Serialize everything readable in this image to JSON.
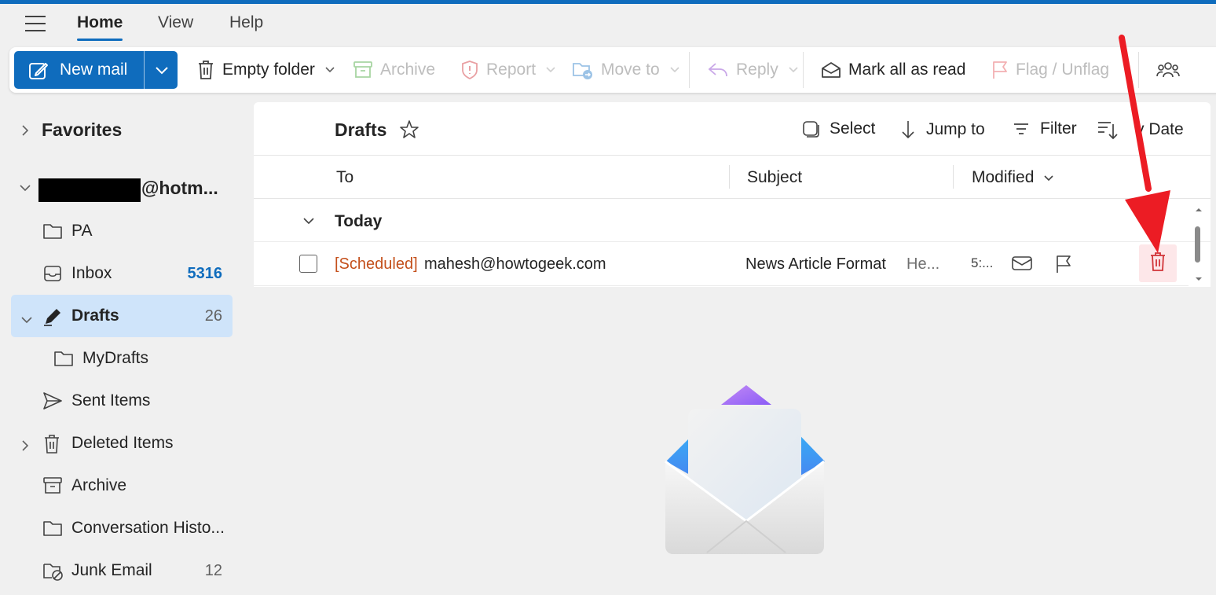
{
  "menu": {
    "tabs": [
      "Home",
      "View",
      "Help"
    ]
  },
  "ribbon": {
    "new_mail": "New mail",
    "empty_folder": "Empty folder",
    "archive": "Archive",
    "report": "Report",
    "move_to": "Move to",
    "reply": "Reply",
    "mark_all_read": "Mark all as read",
    "flag_unflag": "Flag / Unflag"
  },
  "sidebar": {
    "favorites": "Favorites",
    "account_suffix": "@hotm...",
    "folders": [
      {
        "label": "PA",
        "count": ""
      },
      {
        "label": "Inbox",
        "count": "5316"
      },
      {
        "label": "Drafts",
        "count": "26"
      },
      {
        "label": "MyDrafts",
        "count": ""
      },
      {
        "label": "Sent Items",
        "count": ""
      },
      {
        "label": "Deleted Items",
        "count": ""
      },
      {
        "label": "Archive",
        "count": ""
      },
      {
        "label": "Conversation Histo...",
        "count": ""
      },
      {
        "label": "Junk Email",
        "count": "12"
      }
    ]
  },
  "list": {
    "title": "Drafts",
    "actions": {
      "select": "Select",
      "jump_to": "Jump to",
      "filter": "Filter",
      "sort": "y Date"
    },
    "columns": {
      "to": "To",
      "subject": "Subject",
      "modified": "Modified"
    },
    "group": "Today",
    "rows": [
      {
        "tag": "[Scheduled]",
        "to": "mahesh@howtogeek.com",
        "subject": "News Article Format",
        "preview": "He...",
        "time": "5:..."
      }
    ]
  },
  "colors": {
    "accent": "#0f6cbd",
    "scheduled": "#c4501c",
    "delete": "#d13438",
    "selected": "#cfe4fa"
  },
  "icons": [
    "menu-icon",
    "compose-icon",
    "chevron-down-icon",
    "trash-icon",
    "archive-icon",
    "shield-icon",
    "folder-move-icon",
    "reply-icon",
    "envelope-open-icon",
    "flag-icon",
    "people-icon",
    "star-icon",
    "select-icon",
    "arrow-down-icon",
    "filter-icon",
    "sort-icon",
    "folder-icon",
    "inbox-icon",
    "pencil-icon",
    "send-icon",
    "junk-icon",
    "mail-icon"
  ]
}
